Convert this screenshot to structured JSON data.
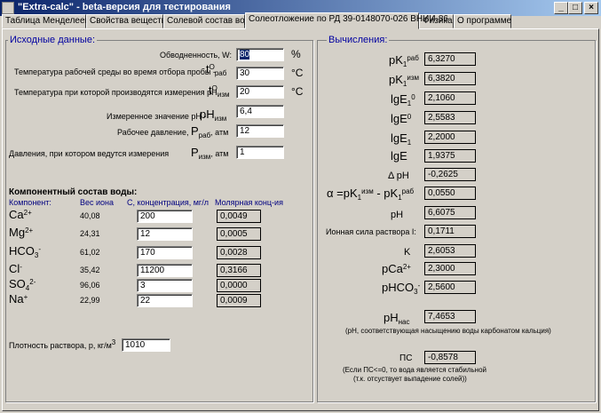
{
  "window": {
    "title": "\"Extra-calc\" - beta-версия для тестирования"
  },
  "tabs": [
    "Таблица Менделеева",
    "Свойства вещества",
    "Солевой состав воды",
    "Солеотложение по РД 39-0148070-026 ВНИИ-86",
    "Физика",
    "О программе"
  ],
  "input": {
    "title": "Исходные данные:",
    "watercut_label": "Обводненность, W:",
    "watercut_value": "80",
    "watercut_unit": "%",
    "t_work_label": "Температура рабочей среды во время отбора пробы -",
    "t_work_sym": "t",
    "t_work_sup": "O",
    "t_work_sub": "раб",
    "t_work_value": "30",
    "t_unit": "°C",
    "t_meas_label": "Температура при которой производятся измерения pH",
    "t_meas_sym": "t",
    "t_meas_sup": "O",
    "t_meas_sub": "изм",
    "t_meas_value": "20",
    "ph_label": "Измеренное значение pH -",
    "ph_sym": "pH",
    "ph_sub": "изм",
    "ph_value": "6,4",
    "p_work_label": "Рабочее давление,",
    "p_work_sym": "P",
    "p_work_sub": "раб",
    "p_work_unit": ", атм",
    "p_work_value": "12",
    "p_meas_label": "Давления, при котором ведутся измерения",
    "p_meas_sym": "P",
    "p_meas_sub": "изм",
    "p_meas_unit": ", атм",
    "p_meas_value": "1"
  },
  "composition": {
    "title": "Компонентный состав воды:",
    "headers": [
      "Компонент:",
      "Вес иона",
      "С, концентрация, мг/л",
      "Молярная конц-ия"
    ],
    "rows": [
      {
        "base": "Ca",
        "sup": "2+",
        "sub": "",
        "weight": "40,08",
        "conc": "200",
        "molar": "0,0049"
      },
      {
        "base": "Mg",
        "sup": "2+",
        "sub": "",
        "weight": "24,31",
        "conc": "12",
        "molar": "0,0005"
      },
      {
        "base": "HCO",
        "sup": "-",
        "sub": "3",
        "weight": "61,02",
        "conc": "170",
        "molar": "0,0028"
      },
      {
        "base": "Cl",
        "sup": "-",
        "sub": "",
        "weight": "35,42",
        "conc": "11200",
        "molar": "0,3166"
      },
      {
        "base": "SO",
        "sup": "2-",
        "sub": "4",
        "weight": "96,06",
        "conc": "3",
        "molar": "0,0000"
      },
      {
        "base": "Na",
        "sup": "+",
        "sub": "",
        "weight": "22,99",
        "conc": "22",
        "molar": "0,0009"
      }
    ],
    "density_label": "Плотность раствора, p, кг/м",
    "density_sup": "3",
    "density_value": "1010"
  },
  "calc": {
    "title": "Вычисления:",
    "pk1_work": {
      "base": "pK",
      "sup": "раб",
      "sub": "1",
      "value": "6,3270"
    },
    "pk1_meas": {
      "base": "pK",
      "sup": "изм",
      "sub": "1",
      "value": "6,3820"
    },
    "lge1_0": {
      "base": "lgE",
      "sup": "0",
      "sub": "1",
      "value": "2,1060"
    },
    "lge_0": {
      "base": "lgE",
      "sup": "0",
      "sub": "",
      "value": "2,5583"
    },
    "lge1": {
      "base": "lgE",
      "sup": "",
      "sub": "1",
      "value": "2,2000"
    },
    "lge": {
      "base": "lgE",
      "value": "1,9375"
    },
    "dph": {
      "label": "Δ pH",
      "value": "-0,2625"
    },
    "alpha": {
      "label": "α =pK",
      "sup1": "изм",
      "sub1": "1",
      "mid": " - pK",
      "sup2": "раб",
      "sub2": "1",
      "value": "0,0550"
    },
    "ph": {
      "label": "pH",
      "value": "6,6075"
    },
    "ionic": {
      "label": "Ионная сила раствора I:",
      "value": "0,1711"
    },
    "k": {
      "label": "K",
      "value": "2,6053"
    },
    "pca": {
      "base": "pCa",
      "sup": "2+",
      "value": "2,3000"
    },
    "phco3": {
      "base": "pHCO",
      "sup": "-",
      "sub": "3",
      "value": "2,5600"
    },
    "phnas": {
      "base": "pH",
      "sub": "нас",
      "value": "7,4653",
      "note": "(pH, соответствующая насыщению воды карбонатом кальция)"
    },
    "ps": {
      "label": "ПС",
      "value": "-0,8578",
      "note1": "(Если ПС<=0, то вода является стабильной",
      "note2": "(т.к. отсуствует выпадение солей))"
    }
  }
}
